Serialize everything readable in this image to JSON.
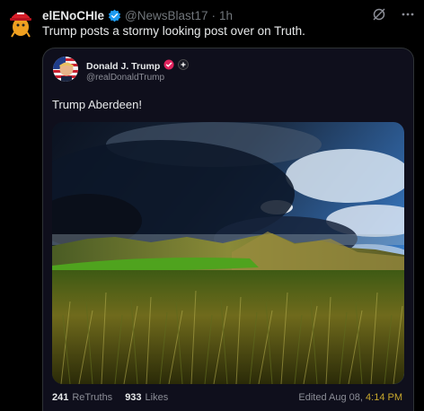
{
  "post": {
    "author_name": "elENoCHIe",
    "handle": "@NewsBlast17",
    "separator": "·",
    "time": "1h",
    "text": "Trump posts a stormy looking post over on Truth."
  },
  "quoted_post": {
    "author_name": "Donald J. Trump",
    "handle": "@realDonaldTrump",
    "text": "Trump Aberdeen!",
    "photo_description": "dark stormy clouds over grassy sand dunes",
    "retruths_count": "241",
    "retruths_label": "ReTruths",
    "likes_count": "933",
    "likes_label": "Likes",
    "edited_label": "Edited Aug 08,",
    "edited_time": "4:14 PM"
  },
  "colors": {
    "verified_blue": "#1d9bf0",
    "truth_badge_red": "#e0245e",
    "edited_time_gold": "#c7a72c"
  },
  "icons": [
    "verified-badge-icon",
    "grok-icon",
    "more-options-icon",
    "truth-verified-icon",
    "plus-badge-icon"
  ]
}
